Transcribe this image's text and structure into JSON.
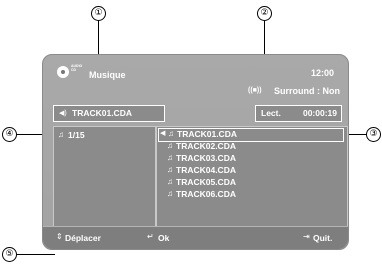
{
  "callouts": [
    "①",
    "②",
    "③",
    "④",
    "⑤"
  ],
  "header": {
    "disc_badge": "AUDIO CD",
    "title": "Musique",
    "time": "12:00",
    "surround_icon": "((■))",
    "surround": "Surround : Non"
  },
  "now_playing": {
    "icon": "speaker-icon",
    "track": "TRACK01.CDA"
  },
  "playback": {
    "mode": "Lect.",
    "elapsed": "00:00:19"
  },
  "left_panel": {
    "counter": "1/15"
  },
  "tracks": [
    "TRACK01.CDA",
    "TRACK02.CDA",
    "TRACK03.CDA",
    "TRACK04.CDA",
    "TRACK05.CDA",
    "TRACK06.CDA"
  ],
  "footer": {
    "move": "Déplacer",
    "ok": "Ok",
    "quit": "Quit."
  },
  "colors": {
    "screen_bg": "#a6a6a6",
    "panel_bg": "#8b8b8b",
    "text": "#ffffff"
  }
}
